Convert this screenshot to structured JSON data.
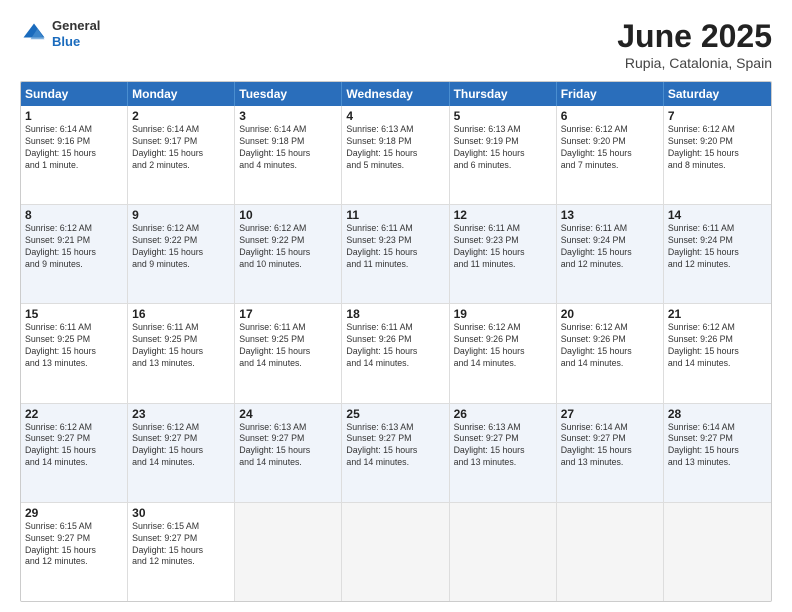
{
  "logo": {
    "general": "General",
    "blue": "Blue"
  },
  "title": "June 2025",
  "subtitle": "Rupia, Catalonia, Spain",
  "header_days": [
    "Sunday",
    "Monday",
    "Tuesday",
    "Wednesday",
    "Thursday",
    "Friday",
    "Saturday"
  ],
  "rows": [
    [
      {
        "day": "1",
        "info": "Sunrise: 6:14 AM\nSunset: 9:16 PM\nDaylight: 15 hours\nand 1 minute."
      },
      {
        "day": "2",
        "info": "Sunrise: 6:14 AM\nSunset: 9:17 PM\nDaylight: 15 hours\nand 2 minutes."
      },
      {
        "day": "3",
        "info": "Sunrise: 6:14 AM\nSunset: 9:18 PM\nDaylight: 15 hours\nand 4 minutes."
      },
      {
        "day": "4",
        "info": "Sunrise: 6:13 AM\nSunset: 9:18 PM\nDaylight: 15 hours\nand 5 minutes."
      },
      {
        "day": "5",
        "info": "Sunrise: 6:13 AM\nSunset: 9:19 PM\nDaylight: 15 hours\nand 6 minutes."
      },
      {
        "day": "6",
        "info": "Sunrise: 6:12 AM\nSunset: 9:20 PM\nDaylight: 15 hours\nand 7 minutes."
      },
      {
        "day": "7",
        "info": "Sunrise: 6:12 AM\nSunset: 9:20 PM\nDaylight: 15 hours\nand 8 minutes."
      }
    ],
    [
      {
        "day": "8",
        "info": "Sunrise: 6:12 AM\nSunset: 9:21 PM\nDaylight: 15 hours\nand 9 minutes."
      },
      {
        "day": "9",
        "info": "Sunrise: 6:12 AM\nSunset: 9:22 PM\nDaylight: 15 hours\nand 9 minutes."
      },
      {
        "day": "10",
        "info": "Sunrise: 6:12 AM\nSunset: 9:22 PM\nDaylight: 15 hours\nand 10 minutes."
      },
      {
        "day": "11",
        "info": "Sunrise: 6:11 AM\nSunset: 9:23 PM\nDaylight: 15 hours\nand 11 minutes."
      },
      {
        "day": "12",
        "info": "Sunrise: 6:11 AM\nSunset: 9:23 PM\nDaylight: 15 hours\nand 11 minutes."
      },
      {
        "day": "13",
        "info": "Sunrise: 6:11 AM\nSunset: 9:24 PM\nDaylight: 15 hours\nand 12 minutes."
      },
      {
        "day": "14",
        "info": "Sunrise: 6:11 AM\nSunset: 9:24 PM\nDaylight: 15 hours\nand 12 minutes."
      }
    ],
    [
      {
        "day": "15",
        "info": "Sunrise: 6:11 AM\nSunset: 9:25 PM\nDaylight: 15 hours\nand 13 minutes."
      },
      {
        "day": "16",
        "info": "Sunrise: 6:11 AM\nSunset: 9:25 PM\nDaylight: 15 hours\nand 13 minutes."
      },
      {
        "day": "17",
        "info": "Sunrise: 6:11 AM\nSunset: 9:25 PM\nDaylight: 15 hours\nand 14 minutes."
      },
      {
        "day": "18",
        "info": "Sunrise: 6:11 AM\nSunset: 9:26 PM\nDaylight: 15 hours\nand 14 minutes."
      },
      {
        "day": "19",
        "info": "Sunrise: 6:12 AM\nSunset: 9:26 PM\nDaylight: 15 hours\nand 14 minutes."
      },
      {
        "day": "20",
        "info": "Sunrise: 6:12 AM\nSunset: 9:26 PM\nDaylight: 15 hours\nand 14 minutes."
      },
      {
        "day": "21",
        "info": "Sunrise: 6:12 AM\nSunset: 9:26 PM\nDaylight: 15 hours\nand 14 minutes."
      }
    ],
    [
      {
        "day": "22",
        "info": "Sunrise: 6:12 AM\nSunset: 9:27 PM\nDaylight: 15 hours\nand 14 minutes."
      },
      {
        "day": "23",
        "info": "Sunrise: 6:12 AM\nSunset: 9:27 PM\nDaylight: 15 hours\nand 14 minutes."
      },
      {
        "day": "24",
        "info": "Sunrise: 6:13 AM\nSunset: 9:27 PM\nDaylight: 15 hours\nand 14 minutes."
      },
      {
        "day": "25",
        "info": "Sunrise: 6:13 AM\nSunset: 9:27 PM\nDaylight: 15 hours\nand 14 minutes."
      },
      {
        "day": "26",
        "info": "Sunrise: 6:13 AM\nSunset: 9:27 PM\nDaylight: 15 hours\nand 13 minutes."
      },
      {
        "day": "27",
        "info": "Sunrise: 6:14 AM\nSunset: 9:27 PM\nDaylight: 15 hours\nand 13 minutes."
      },
      {
        "day": "28",
        "info": "Sunrise: 6:14 AM\nSunset: 9:27 PM\nDaylight: 15 hours\nand 13 minutes."
      }
    ],
    [
      {
        "day": "29",
        "info": "Sunrise: 6:15 AM\nSunset: 9:27 PM\nDaylight: 15 hours\nand 12 minutes."
      },
      {
        "day": "30",
        "info": "Sunrise: 6:15 AM\nSunset: 9:27 PM\nDaylight: 15 hours\nand 12 minutes."
      },
      {
        "day": "",
        "info": ""
      },
      {
        "day": "",
        "info": ""
      },
      {
        "day": "",
        "info": ""
      },
      {
        "day": "",
        "info": ""
      },
      {
        "day": "",
        "info": ""
      }
    ]
  ]
}
